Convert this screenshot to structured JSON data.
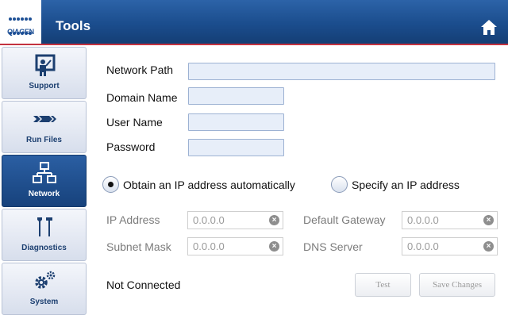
{
  "header": {
    "logo_text": "QIAGEN",
    "title": "Tools"
  },
  "icons": {
    "home": "home-icon",
    "support": "support-presenter-icon",
    "run_files": "run-files-arrows-icon",
    "network": "network-topology-icon",
    "diagnostics": "diagnostics-tools-icon",
    "system": "system-gears-icon",
    "clear": "clear-circle-icon"
  },
  "sidebar": {
    "items": [
      {
        "label": "Support"
      },
      {
        "label": "Run Files"
      },
      {
        "label": "Network"
      },
      {
        "label": "Diagnostics"
      },
      {
        "label": "System"
      }
    ],
    "active_index": 2
  },
  "form": {
    "network_path": {
      "label": "Network Path",
      "value": ""
    },
    "domain_name": {
      "label": "Domain Name",
      "value": ""
    },
    "user_name": {
      "label": "User Name",
      "value": ""
    },
    "password": {
      "label": "Password",
      "value": ""
    }
  },
  "ip_mode": {
    "automatic_label": "Obtain an IP address automatically",
    "manual_label": "Specify an IP address",
    "selected": "automatic"
  },
  "ip_settings": {
    "ip_address": {
      "label": "IP Address",
      "value": "0.0.0.0"
    },
    "subnet_mask": {
      "label": "Subnet Mask",
      "value": "0.0.0.0"
    },
    "default_gateway": {
      "label": "Default Gateway",
      "value": "0.0.0.0"
    },
    "dns_server": {
      "label": "DNS Server",
      "value": "0.0.0.0"
    }
  },
  "footer": {
    "status": "Not Connected",
    "test_label": "Test",
    "save_label": "Save Changes"
  },
  "colors": {
    "header_blue": "#1b4d8d",
    "accent_red": "#c3323f",
    "active_nav": "#17427c",
    "field_fill": "#e7eef9"
  }
}
